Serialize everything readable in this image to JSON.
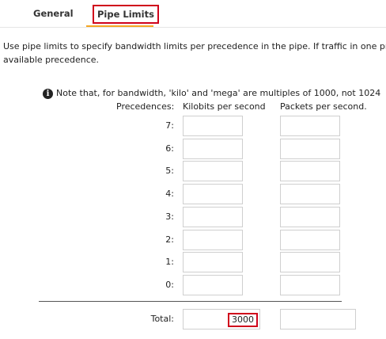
{
  "tabs": {
    "general": "General",
    "pipe_limits": "Pipe Limits"
  },
  "description": {
    "line1": "Use pipe limits to specify bandwidth limits per precedence in the pipe. If traffic in one pre",
    "line2": "available precedence."
  },
  "note": {
    "icon": "info-icon",
    "text": "Note that, for bandwidth, 'kilo' and 'mega' are multiples of 1000, not 1024"
  },
  "table": {
    "headers": {
      "precedences": "Precedences:",
      "kilobits": "Kilobits per second",
      "packets": "Packets per second."
    },
    "rows": [
      {
        "label": "7:",
        "kilobits": "",
        "packets": ""
      },
      {
        "label": "6:",
        "kilobits": "",
        "packets": ""
      },
      {
        "label": "5:",
        "kilobits": "",
        "packets": ""
      },
      {
        "label": "4:",
        "kilobits": "",
        "packets": ""
      },
      {
        "label": "3:",
        "kilobits": "",
        "packets": ""
      },
      {
        "label": "2:",
        "kilobits": "",
        "packets": ""
      },
      {
        "label": "1:",
        "kilobits": "",
        "packets": ""
      },
      {
        "label": "0:",
        "kilobits": "",
        "packets": ""
      }
    ],
    "total": {
      "label": "Total:",
      "kilobits": "3000",
      "packets": ""
    }
  },
  "colors": {
    "highlight": "#d0021b",
    "active_tab_underline": "#f5a623"
  }
}
